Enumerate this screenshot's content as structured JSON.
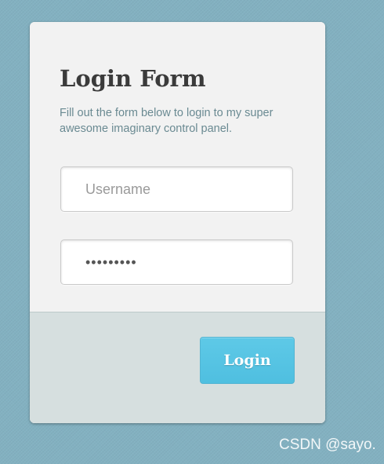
{
  "login_form": {
    "title": "Login Form",
    "description": "Fill out the form below to login to my super awesome imaginary control panel.",
    "username": {
      "placeholder": "Username",
      "value": ""
    },
    "password": {
      "value": "password1"
    },
    "login_label": "Login"
  },
  "watermark": "CSDN @sayo.",
  "colors": {
    "background": "#83b1c1",
    "card": "#f2f2f2",
    "footer": "#d6dfdf",
    "button": "#5ec9e7",
    "title_text": "#3b3b3b",
    "description_text": "#6a8a92"
  }
}
